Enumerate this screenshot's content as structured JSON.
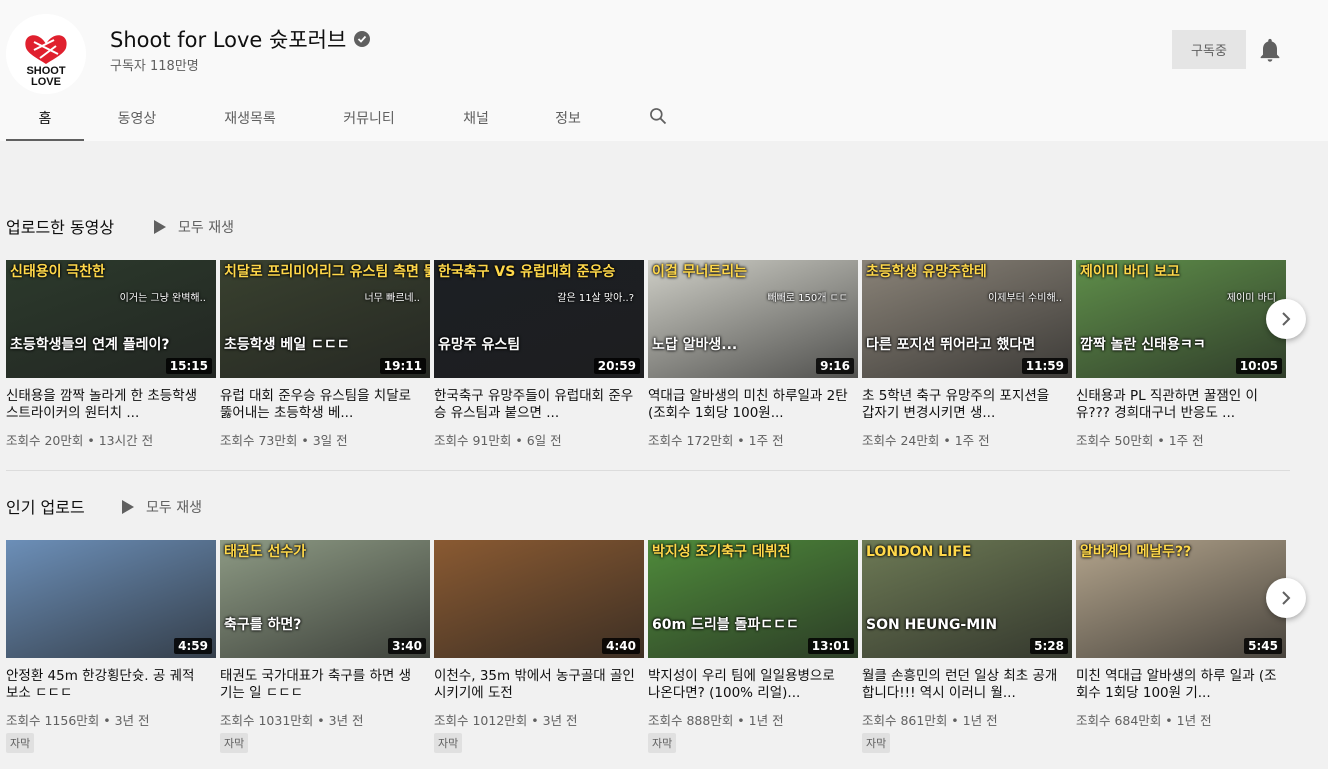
{
  "channel": {
    "name": "Shoot for Love 슛포러브",
    "subscribers": "구독자 118만명",
    "subscribe_label": "구독중",
    "logo_text_top": "SHOOT",
    "logo_text_bottom": "LOVE"
  },
  "tabs": [
    "홈",
    "동영상",
    "재생목록",
    "커뮤니티",
    "채널",
    "정보"
  ],
  "sections": [
    {
      "title": "업로드한 동영상",
      "play_all": "모두 재생",
      "videos": [
        {
          "thumb_text": [
            "신태용이 극찬한",
            "초등학생들의 연계 플레이?"
          ],
          "thumb_small": "이거는 그냥 완벽해..",
          "duration": "15:15",
          "title": "신태용을 깜짝 놀라게 한 초등학생 스트라이커의 원터치 ...",
          "meta": "조회수 20만회 • 13시간 전",
          "color": "#2c3a2c"
        },
        {
          "thumb_text": [
            "치달로 프리미어리그 유스팀 측면 뚫는",
            "초등학생 베일 ㄷㄷㄷ"
          ],
          "thumb_small": "너무 빠르네..",
          "duration": "19:11",
          "title": "유럽 대회 준우승 유스팀을 치달로 뚫어내는 초등학생 베...",
          "meta": "조회수 73만회 • 3일 전",
          "color": "#39412f"
        },
        {
          "thumb_text": [
            "한국축구 VS 유럽대회 준우승",
            "유망주 유스팀"
          ],
          "thumb_small": "갈은 11살 맞아..?",
          "duration": "20:59",
          "title": "한국축구 유망주들이 유럽대회 준우승 유스팀과 붙으면 ...",
          "meta": "조회수 91만회 • 6일 전",
          "color": "#1c1f24"
        },
        {
          "thumb_text": [
            "이걸 무너트리는",
            "노답 알바생..."
          ],
          "thumb_small": "빼빼로 150개 ㄷㄷ",
          "duration": "9:16",
          "title": "역대급 알바생의 미친 하루일과 2탄 (조회수 1회당 100원...",
          "meta": "조회수 172만회 • 1주 전",
          "color": "#cfcfc7"
        },
        {
          "thumb_text": [
            "초등학생 유망주한테",
            "다른 포지션 뛰어라고 했다면"
          ],
          "thumb_small": "이제부터 수비해..",
          "duration": "11:59",
          "title": "초 5학년 축구 유망주의 포지션을 갑자기 변경시키면 생...",
          "meta": "조회수 24만회 • 1주 전",
          "color": "#8a8378"
        },
        {
          "thumb_text": [
            "제이미 바디 보고",
            "깜짝 놀란 신태용ㅋㅋ"
          ],
          "thumb_small": "제이미 바디",
          "duration": "10:05",
          "title": "신태용과 PL 직관하면 꿀잼인 이유??? 경희대구너 반응도 ...",
          "meta": "조회수 50만회 • 1주 전",
          "color": "#5f8f4a"
        }
      ]
    },
    {
      "title": "인기 업로드",
      "play_all": "모두 재생",
      "videos": [
        {
          "thumb_text": [
            "",
            ""
          ],
          "thumb_small": "",
          "duration": "4:59",
          "title": "안정환 45m 한강횡단슛. 공 궤적 보소 ㄷㄷㄷ",
          "meta": "조회수 1156만회 • 3년 전",
          "badge": "자막",
          "color": "#6c8fb8"
        },
        {
          "thumb_text": [
            "태권도 선수가",
            "축구를 하면?"
          ],
          "thumb_small": "",
          "duration": "3:40",
          "title": "태권도 국가대표가 축구를 하면 생기는 일 ㄷㄷㄷ",
          "meta": "조회수 1031만회 • 3년 전",
          "badge": "자막",
          "color": "#8d9a84"
        },
        {
          "thumb_text": [
            "",
            ""
          ],
          "thumb_small": "",
          "duration": "4:40",
          "title": "이천수, 35m 밖에서 농구골대 골인시키기에 도전",
          "meta": "조회수 1012만회 • 3년 전",
          "badge": "자막",
          "color": "#8a5a32"
        },
        {
          "thumb_text": [
            "박지성 조기축구 데뷔전",
            "60m 드리블 돌파ㄷㄷㄷ"
          ],
          "thumb_small": "",
          "duration": "13:01",
          "title": "박지성이 우리 팀에 일일용병으로 나온다면? (100% 리얼)...",
          "meta": "조회수 888만회 • 1년 전",
          "badge": "자막",
          "color": "#4f8b3b"
        },
        {
          "thumb_text": [
            "LONDON LIFE",
            "SON HEUNG-MIN"
          ],
          "thumb_small": "",
          "duration": "5:28",
          "title": "월클 손흥민의 런던 일상 최초 공개합니다!!! 역시 이러니 월...",
          "meta": "조회수 861만회 • 1년 전",
          "badge": "자막",
          "color": "#6d7a55"
        },
        {
          "thumb_text": [
            "알바계의 메날두??",
            ""
          ],
          "thumb_small": "",
          "duration": "5:45",
          "title": "미친 역대급 알바생의 하루 일과 (조회수 1회당 100원 기...",
          "meta": "조회수 684만회 • 1년 전",
          "color": "#b3a48c"
        }
      ]
    }
  ],
  "icons": {
    "search": "search-icon",
    "bell": "bell-icon",
    "verified": "verified-icon",
    "next": "chevron-right-icon",
    "play": "play-icon"
  }
}
